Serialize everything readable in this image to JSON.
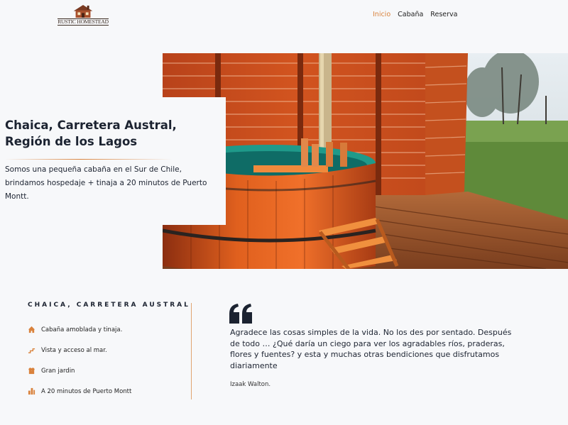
{
  "header": {
    "logo_text": "RUSTIC HOMESTEAD",
    "nav": [
      {
        "label": "Inicio",
        "active": true
      },
      {
        "label": "Cabaña",
        "active": false
      },
      {
        "label": "Reserva",
        "active": false
      }
    ]
  },
  "hero": {
    "title": "Chaica, Carretera Austral, Región de los Lagos",
    "description": "Somos una pequeña cabaña en el Sur de Chile, brindamos hospedaje + tinaja a 20 minutos de Puerto Montt.",
    "image": "wooden-hot-tub-on-deck"
  },
  "features": {
    "title": "CHAICA, CARRETERA AUSTRAL",
    "items": [
      {
        "icon": "cabin-icon",
        "label": "Cabaña amoblada y tinaja."
      },
      {
        "icon": "sea-view-icon",
        "label": "Vista y acceso al mar."
      },
      {
        "icon": "garden-icon",
        "label": "Gran jardin"
      },
      {
        "icon": "city-icon",
        "label": "A 20 minutos de Puerto Montt"
      }
    ]
  },
  "quote": {
    "text": "Agradece las cosas simples de la vida. No los des por sentado. Después de todo … ¿Qué daría un ciego para ver los agradables ríos, praderas, flores y fuentes? y esta y muchas otras bendiciones que disfrutamos diariamente",
    "author": "Izaak Walton."
  },
  "colors": {
    "accent": "#d9823c",
    "text": "#1c2331",
    "background": "#f7f8fa"
  }
}
